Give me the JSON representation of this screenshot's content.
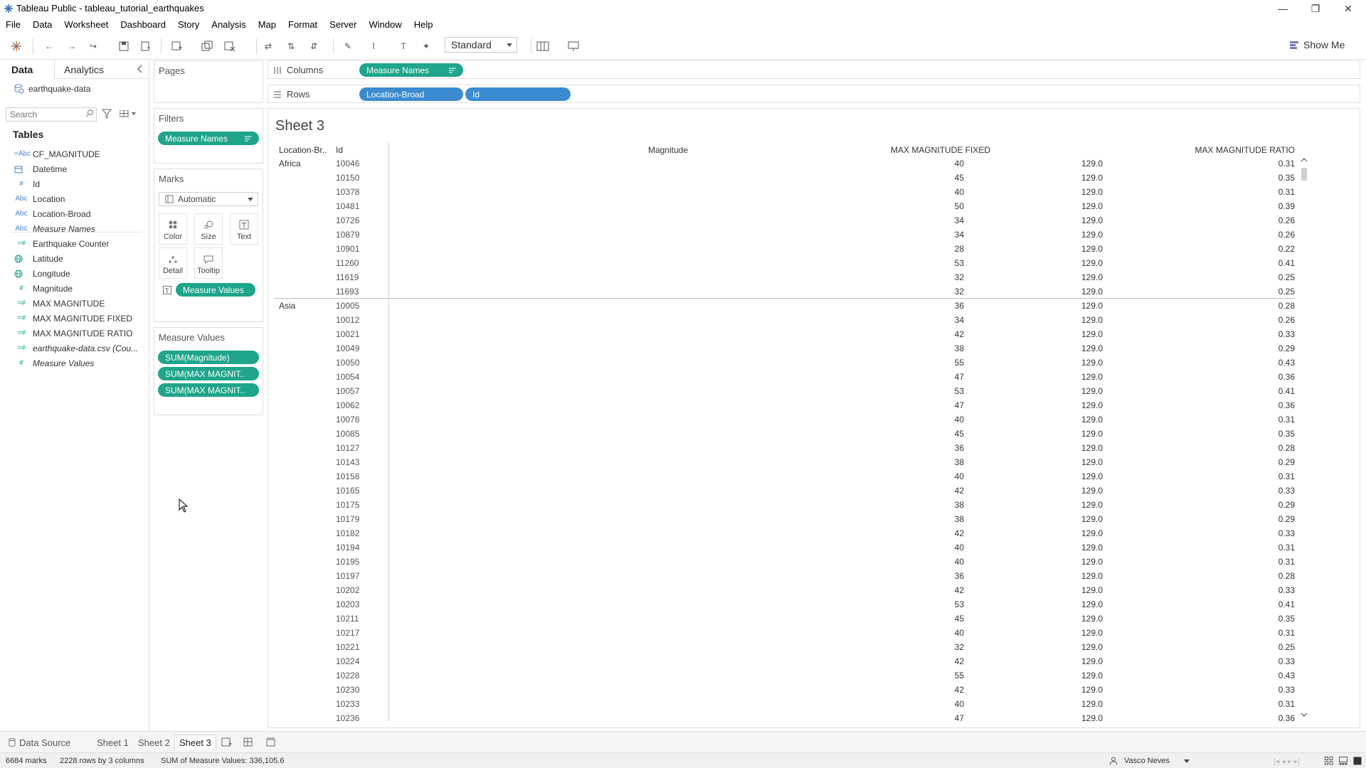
{
  "window": {
    "title": "Tableau Public - tableau_tutorial_earthquakes"
  },
  "menu": [
    {
      "label": "File"
    },
    {
      "label": "Data"
    },
    {
      "label": "Worksheet"
    },
    {
      "label": "Dashboard"
    },
    {
      "label": "Story"
    },
    {
      "label": "Analysis"
    },
    {
      "label": "Map"
    },
    {
      "label": "Format"
    },
    {
      "label": "Server"
    },
    {
      "label": "Window"
    },
    {
      "label": "Help"
    }
  ],
  "toolbar": {
    "fit_select": "Standard",
    "show_me": "Show Me"
  },
  "data_pane": {
    "tab_data": "Data",
    "tab_analytics": "Analytics",
    "datasource": "earthquake-data",
    "search_placeholder": "Search",
    "tables_label": "Tables",
    "fields": [
      {
        "name": "CF_MAGNITUDE",
        "type": "=Abc",
        "kind": "dim"
      },
      {
        "name": "Datetime",
        "type": "cal",
        "kind": "dim"
      },
      {
        "name": "Id",
        "type": "#",
        "kind": "dim"
      },
      {
        "name": "Location",
        "type": "Abc",
        "kind": "dim"
      },
      {
        "name": "Location-Broad",
        "type": "Abc",
        "kind": "dim"
      },
      {
        "name": "Measure Names",
        "type": "Abc",
        "kind": "dim",
        "italic": true
      },
      {
        "name": "Earthquake Counter",
        "type": "=#",
        "kind": "mea"
      },
      {
        "name": "Latitude",
        "type": "geo",
        "kind": "mea"
      },
      {
        "name": "Longitude",
        "type": "geo",
        "kind": "mea"
      },
      {
        "name": "Magnitude",
        "type": "#",
        "kind": "mea"
      },
      {
        "name": "MAX MAGNITUDE",
        "type": "=#",
        "kind": "mea"
      },
      {
        "name": "MAX MAGNITUDE FIXED",
        "type": "=#",
        "kind": "mea"
      },
      {
        "name": "MAX MAGNITUDE RATIO",
        "type": "=#",
        "kind": "mea"
      },
      {
        "name": "earthquake-data.csv (Cou...",
        "type": "=#",
        "kind": "mea",
        "italic": true
      },
      {
        "name": "Measure Values",
        "type": "#",
        "kind": "mea",
        "italic": true
      }
    ]
  },
  "pages": {
    "title": "Pages"
  },
  "filters": {
    "title": "Filters",
    "pill": "Measure Names"
  },
  "marks": {
    "title": "Marks",
    "type": "Automatic",
    "buttons": [
      {
        "label": "Color"
      },
      {
        "label": "Size"
      },
      {
        "label": "Text"
      },
      {
        "label": "Detail"
      },
      {
        "label": "Tooltip"
      }
    ],
    "text_pill": "Measure Values"
  },
  "measure_values": {
    "title": "Measure Values",
    "pills": [
      "SUM(Magnitude)",
      "SUM(MAX MAGNIT..",
      "SUM(MAX MAGNIT.."
    ]
  },
  "shelves": {
    "columns_label": "Columns",
    "columns_pill": "Measure Names",
    "rows_label": "Rows",
    "rows_pills": [
      "Location-Broad",
      "Id"
    ]
  },
  "sheet": {
    "title": "Sheet 3",
    "headers": {
      "loc": "Location-Br..",
      "id": "Id",
      "mag": "Magnitude",
      "fixed": "MAX MAGNITUDE FIXED",
      "ratio": "MAX MAGNITUDE RATIO"
    },
    "rows": [
      {
        "loc": "Africa",
        "id": "10046",
        "mag": "40",
        "fixed": "129.0",
        "ratio": "0.31"
      },
      {
        "loc": "",
        "id": "10150",
        "mag": "45",
        "fixed": "129.0",
        "ratio": "0.35"
      },
      {
        "loc": "",
        "id": "10378",
        "mag": "40",
        "fixed": "129.0",
        "ratio": "0.31"
      },
      {
        "loc": "",
        "id": "10481",
        "mag": "50",
        "fixed": "129.0",
        "ratio": "0.39"
      },
      {
        "loc": "",
        "id": "10726",
        "mag": "34",
        "fixed": "129.0",
        "ratio": "0.26"
      },
      {
        "loc": "",
        "id": "10879",
        "mag": "34",
        "fixed": "129.0",
        "ratio": "0.26"
      },
      {
        "loc": "",
        "id": "10901",
        "mag": "28",
        "fixed": "129.0",
        "ratio": "0.22"
      },
      {
        "loc": "",
        "id": "11260",
        "mag": "53",
        "fixed": "129.0",
        "ratio": "0.41"
      },
      {
        "loc": "",
        "id": "11619",
        "mag": "32",
        "fixed": "129.0",
        "ratio": "0.25"
      },
      {
        "loc": "",
        "id": "11693",
        "mag": "32",
        "fixed": "129.0",
        "ratio": "0.25"
      },
      {
        "loc": "Asia",
        "id": "10005",
        "mag": "36",
        "fixed": "129.0",
        "ratio": "0.28"
      },
      {
        "loc": "",
        "id": "10012",
        "mag": "34",
        "fixed": "129.0",
        "ratio": "0.26"
      },
      {
        "loc": "",
        "id": "10021",
        "mag": "42",
        "fixed": "129.0",
        "ratio": "0.33"
      },
      {
        "loc": "",
        "id": "10049",
        "mag": "38",
        "fixed": "129.0",
        "ratio": "0.29"
      },
      {
        "loc": "",
        "id": "10050",
        "mag": "55",
        "fixed": "129.0",
        "ratio": "0.43"
      },
      {
        "loc": "",
        "id": "10054",
        "mag": "47",
        "fixed": "129.0",
        "ratio": "0.36"
      },
      {
        "loc": "",
        "id": "10057",
        "mag": "53",
        "fixed": "129.0",
        "ratio": "0.41"
      },
      {
        "loc": "",
        "id": "10062",
        "mag": "47",
        "fixed": "129.0",
        "ratio": "0.36"
      },
      {
        "loc": "",
        "id": "10078",
        "mag": "40",
        "fixed": "129.0",
        "ratio": "0.31"
      },
      {
        "loc": "",
        "id": "10085",
        "mag": "45",
        "fixed": "129.0",
        "ratio": "0.35"
      },
      {
        "loc": "",
        "id": "10127",
        "mag": "36",
        "fixed": "129.0",
        "ratio": "0.28"
      },
      {
        "loc": "",
        "id": "10143",
        "mag": "38",
        "fixed": "129.0",
        "ratio": "0.29"
      },
      {
        "loc": "",
        "id": "10158",
        "mag": "40",
        "fixed": "129.0",
        "ratio": "0.31"
      },
      {
        "loc": "",
        "id": "10165",
        "mag": "42",
        "fixed": "129.0",
        "ratio": "0.33"
      },
      {
        "loc": "",
        "id": "10175",
        "mag": "38",
        "fixed": "129.0",
        "ratio": "0.29"
      },
      {
        "loc": "",
        "id": "10179",
        "mag": "38",
        "fixed": "129.0",
        "ratio": "0.29"
      },
      {
        "loc": "",
        "id": "10182",
        "mag": "42",
        "fixed": "129.0",
        "ratio": "0.33"
      },
      {
        "loc": "",
        "id": "10194",
        "mag": "40",
        "fixed": "129.0",
        "ratio": "0.31"
      },
      {
        "loc": "",
        "id": "10195",
        "mag": "40",
        "fixed": "129.0",
        "ratio": "0.31"
      },
      {
        "loc": "",
        "id": "10197",
        "mag": "36",
        "fixed": "129.0",
        "ratio": "0.28"
      },
      {
        "loc": "",
        "id": "10202",
        "mag": "42",
        "fixed": "129.0",
        "ratio": "0.33"
      },
      {
        "loc": "",
        "id": "10203",
        "mag": "53",
        "fixed": "129.0",
        "ratio": "0.41"
      },
      {
        "loc": "",
        "id": "10211",
        "mag": "45",
        "fixed": "129.0",
        "ratio": "0.35"
      },
      {
        "loc": "",
        "id": "10217",
        "mag": "40",
        "fixed": "129.0",
        "ratio": "0.31"
      },
      {
        "loc": "",
        "id": "10221",
        "mag": "32",
        "fixed": "129.0",
        "ratio": "0.25"
      },
      {
        "loc": "",
        "id": "10224",
        "mag": "42",
        "fixed": "129.0",
        "ratio": "0.33"
      },
      {
        "loc": "",
        "id": "10228",
        "mag": "55",
        "fixed": "129.0",
        "ratio": "0.43"
      },
      {
        "loc": "",
        "id": "10230",
        "mag": "42",
        "fixed": "129.0",
        "ratio": "0.33"
      },
      {
        "loc": "",
        "id": "10233",
        "mag": "40",
        "fixed": "129.0",
        "ratio": "0.31"
      },
      {
        "loc": "",
        "id": "10236",
        "mag": "47",
        "fixed": "129.0",
        "ratio": "0.36"
      }
    ]
  },
  "sheet_tabs": [
    {
      "label": "Data Source"
    },
    {
      "label": "Sheet 1"
    },
    {
      "label": "Sheet 2"
    },
    {
      "label": "Sheet 3",
      "active": true
    }
  ],
  "status": {
    "marks": "6684 marks",
    "rows_cols": "2228 rows by 3 columns",
    "sum": "SUM of Measure Values: 336,105.6",
    "user": "Vasco Neves"
  },
  "colors": {
    "measure_pill": "#1ea58a",
    "dimension_pill": "#3b8bd0"
  }
}
